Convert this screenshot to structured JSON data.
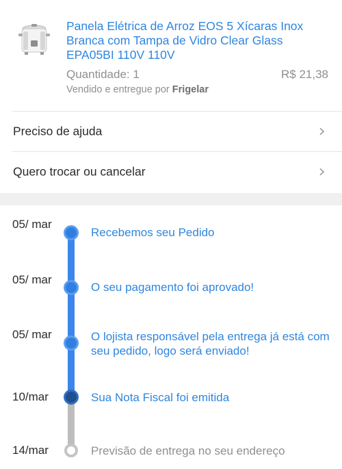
{
  "product": {
    "icon": "rice-cooker-image",
    "title": "Panela Elétrica de Arroz EOS 5 Xícaras Inox Branca com Tampa de Vidro Clear Glass EPA05BI 110V 110V",
    "quantity": "Quantidade: 1",
    "price": "R$ 21,38",
    "seller_prefix": "Vendido e entregue por ",
    "seller_name": "Frigelar"
  },
  "menu": {
    "help": "Preciso de ajuda",
    "exchange": "Quero trocar ou cancelar"
  },
  "timeline": {
    "steps": [
      {
        "date": "05/ mar",
        "text": "Recebemos seu Pedido",
        "state": "done"
      },
      {
        "date": "05/ mar",
        "text": "O seu pagamento foi aprovado!",
        "state": "done"
      },
      {
        "date": "05/ mar",
        "text": "O lojista responsável pela entrega já está com seu pedido, logo será enviado!",
        "state": "done"
      },
      {
        "date": "10/mar",
        "text": "Sua Nota Fiscal foi emitida",
        "state": "current"
      },
      {
        "date": "14/mar",
        "text": "Previsão de entrega no seu endereço",
        "state": "pending"
      }
    ]
  },
  "colors": {
    "accent": "#2f86df",
    "rail_done": "#3b86ea",
    "rail_pending": "#bdbdbd"
  }
}
